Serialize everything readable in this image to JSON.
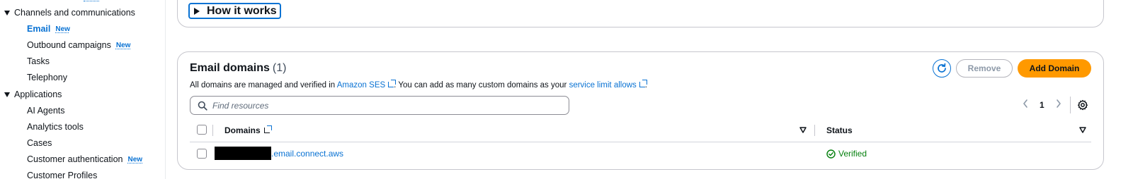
{
  "sidebar": {
    "groups": [
      {
        "label": "Channels and communications",
        "items": [
          {
            "label": "Email",
            "badge": "New",
            "active": true
          },
          {
            "label": "Outbound campaigns",
            "badge": "New"
          },
          {
            "label": "Tasks"
          },
          {
            "label": "Telephony"
          }
        ]
      },
      {
        "label": "Applications",
        "items": [
          {
            "label": "AI Agents"
          },
          {
            "label": "Analytics tools"
          },
          {
            "label": "Cases"
          },
          {
            "label": "Customer authentication",
            "badge": "New"
          },
          {
            "label": "Customer Profiles"
          }
        ]
      }
    ]
  },
  "how_it_works": {
    "label": "How it works"
  },
  "email_domains": {
    "title": "Email domains",
    "count": "(1)",
    "description": {
      "part1": "All domains are managed and verified in ",
      "link1": "Amazon SES",
      "part2": ". You can add as many custom domains as your ",
      "link2": "service limit allows",
      "part3": "."
    },
    "buttons": {
      "remove": "Remove",
      "add": "Add Domain"
    },
    "search": {
      "placeholder": "Find resources"
    },
    "pagination": {
      "current_page": "1"
    },
    "columns": {
      "domains": "Domains",
      "status": "Status"
    },
    "rows": [
      {
        "domain_suffix": ".email.connect.aws",
        "status": "Verified"
      }
    ]
  },
  "colors": {
    "accent": "#0972d3",
    "primary_button": "#ff9900",
    "success": "#037f0c"
  },
  "icons": [
    "refresh-icon",
    "search-icon",
    "chevron-left-icon",
    "chevron-right-icon",
    "gear-icon",
    "external-link-icon",
    "sort-icon",
    "check-circle-icon"
  ]
}
